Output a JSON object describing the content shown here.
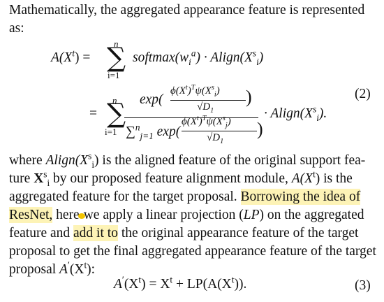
{
  "intro": {
    "line1": "Mathematically, the aggregated appearance feature is represented",
    "line2": "as:"
  },
  "eq2": {
    "lhs": "A(X",
    "sum_top": "n",
    "sum_bottom": "i=1",
    "term1": "softmax(w",
    "term1_tail": ") · Align(X",
    "eq_sign": "=",
    "num_exp": "exp(",
    "num_frac_top": "ϕ(X",
    "num_frac_bot": "√D",
    "den_sum": "∑",
    "den_sum_sup": "n",
    "den_sum_sub": "j=1",
    "den_exp": "exp(",
    "align_tail": "· Align(X",
    "number": "(2)"
  },
  "para2": {
    "l1a": "where ",
    "l1b": "Align(X",
    "l1c": ") is the aligned feature of the original support fea-",
    "l2a": "ture ",
    "l2b": "X",
    "l2c": " by our proposed feature alignment module, ",
    "l2d": "A(X",
    "l2e": ") is the",
    "l3a": "aggregated feature for the target proposal. ",
    "l3hl": "Borrowing the idea of",
    "l4hl": "ResNet,",
    "l4b": " here",
    "l4c": "we apply a linear projection (",
    "l4d": "LP",
    "l4e": ") on the aggregated",
    "l5a": "feature and ",
    "l5hl": "add it to",
    "l5b": " the original appearance feature of the target",
    "l6": "proposal to get the final aggregated appearance feature of the target",
    "l7a": "proposal ",
    "l7b": "A",
    "l7c": "(X",
    "l7d": "):"
  },
  "eq3": {
    "text_a": "A",
    "text_b": "(X",
    "text_c": ") = X",
    "text_d": " + LP(A(X",
    "text_e": ")).",
    "number": "(3)"
  },
  "colors": {
    "highlight": "#fdf3b6",
    "annotation_dot": "#f2c400"
  }
}
